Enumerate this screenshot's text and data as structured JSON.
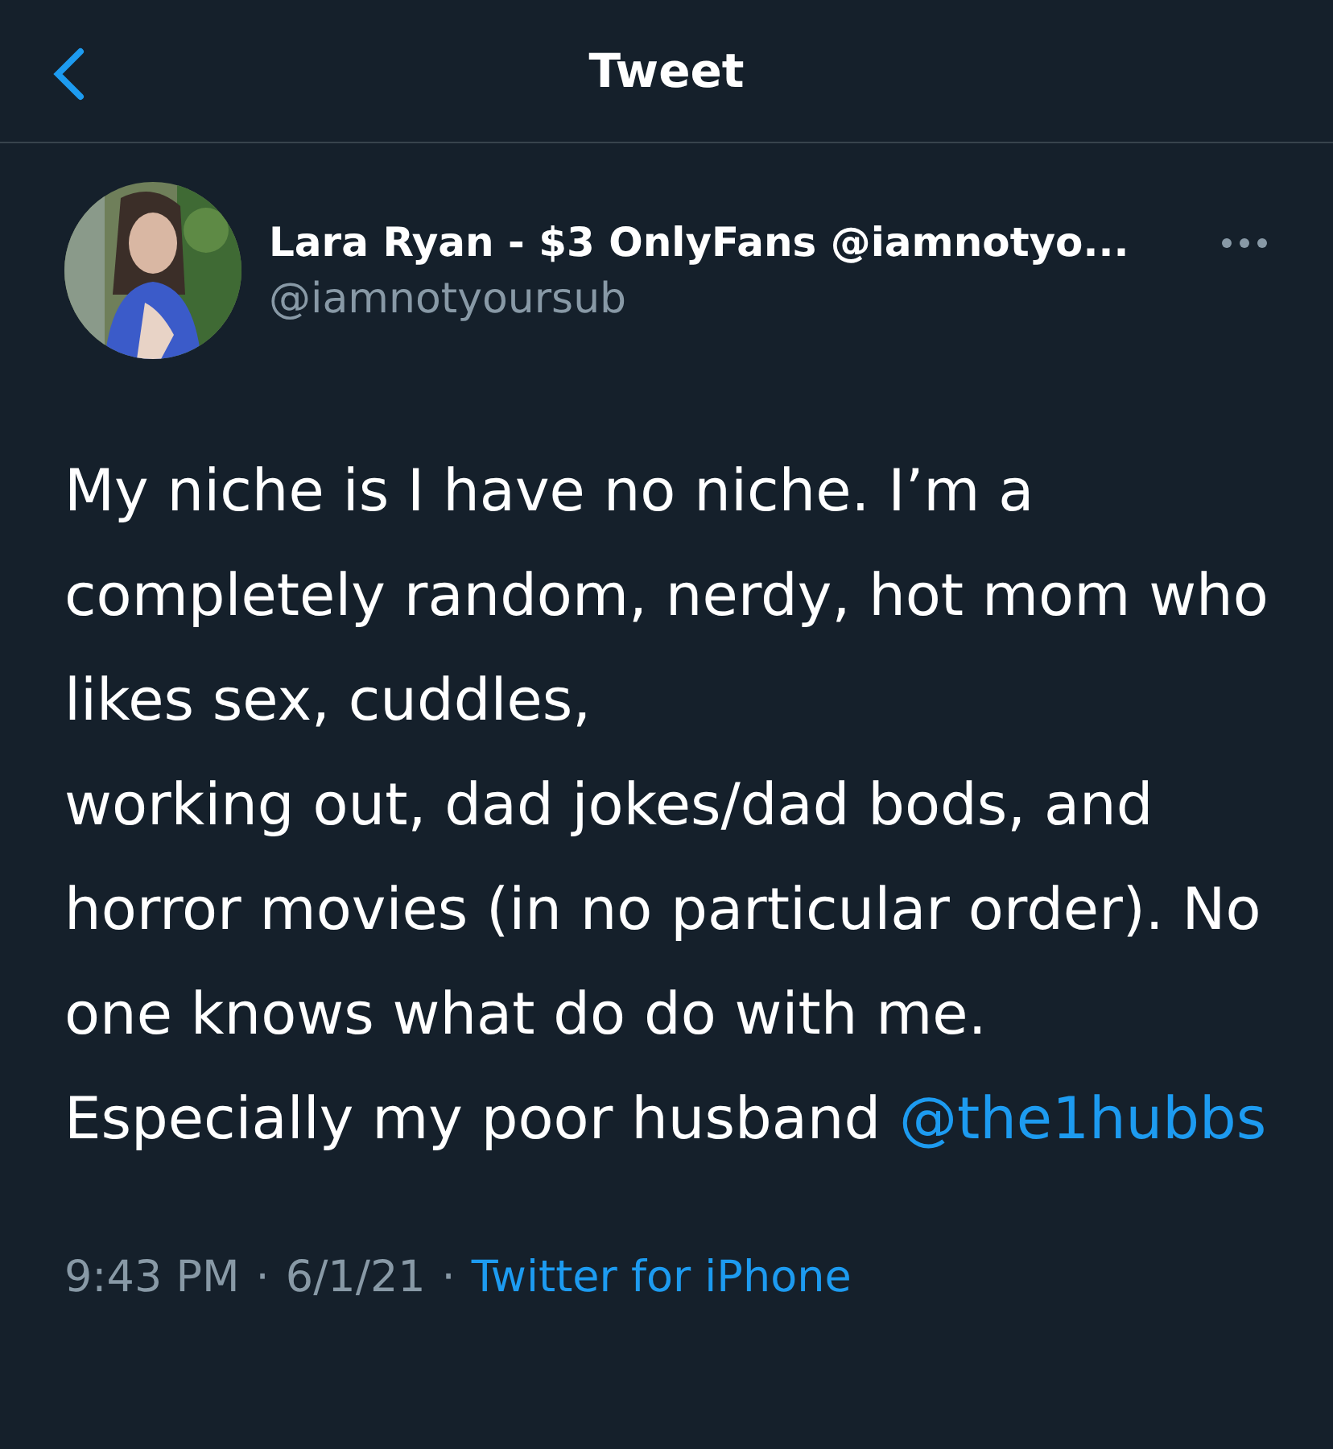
{
  "header": {
    "title": "Tweet"
  },
  "author": {
    "name": "Lara Ryan - $3 OnlyFans @iamnotyo...",
    "handle": "@iamnotyoursub"
  },
  "tweet": {
    "text": "My niche is I have no niche. I’m a completely random, nerdy, hot mom who likes sex, cuddles,\nworking out, dad jokes/dad bods, and horror movies (in no particular order). No one knows what do do with me. Especially my poor husband",
    "mention": "@the1hubbs"
  },
  "meta": {
    "time": "9:43 PM",
    "separator_1": "·",
    "date": "6/1/21",
    "separator_2": "·",
    "source": "Twitter for iPhone"
  }
}
